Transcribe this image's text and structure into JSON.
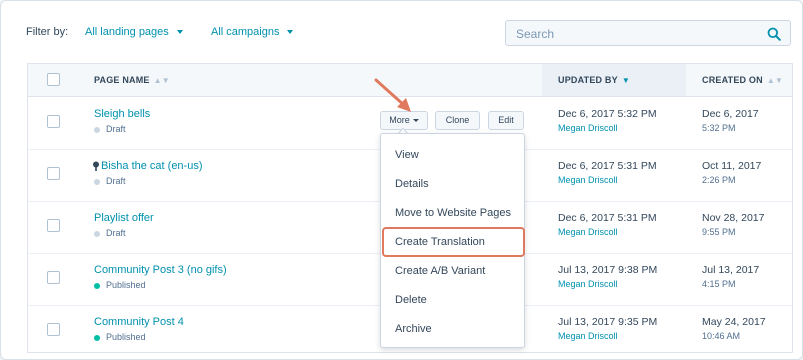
{
  "filter": {
    "label": "Filter by:",
    "landing_pages": "All landing pages",
    "campaigns": "All campaigns"
  },
  "search": {
    "placeholder": "Search"
  },
  "columns": {
    "page_name": "PAGE NAME",
    "updated_by": "UPDATED BY",
    "created_on": "CREATED ON"
  },
  "rows": [
    {
      "name": "Sleigh bells",
      "status": "Draft",
      "updated_date": "Dec 6, 2017 5:32 PM",
      "updated_user": "Megan Driscoll",
      "created_date": "Dec 6, 2017",
      "created_time": "5:32 PM"
    },
    {
      "name": "Bisha the cat (en-us)",
      "status": "Draft",
      "updated_date": "Dec 6, 2017 5:31 PM",
      "updated_user": "Megan Driscoll",
      "created_date": "Oct 11, 2017",
      "created_time": "2:26 PM"
    },
    {
      "name": "Playlist offer",
      "status": "Draft",
      "updated_date": "Dec 6, 2017 5:31 PM",
      "updated_user": "Megan Driscoll",
      "created_date": "Nov 28, 2017",
      "created_time": "9:55 PM"
    },
    {
      "name": "Community Post 3 (no gifs)",
      "status": "Published",
      "updated_date": "Jul 13, 2017 9:38 PM",
      "updated_user": "Megan Driscoll",
      "created_date": "Jul 13, 2017",
      "created_time": "4:15 PM"
    },
    {
      "name": "Community Post 4",
      "status": "Published",
      "updated_date": "Jul 13, 2017 9:35 PM",
      "updated_user": "Megan Driscoll",
      "created_date": "May 24, 2017",
      "created_time": "10:46 AM"
    }
  ],
  "row_actions": {
    "more": "More",
    "clone": "Clone",
    "edit": "Edit"
  },
  "menu": {
    "items": [
      "View",
      "Details",
      "Move to Website Pages",
      "Create Translation",
      "Create A/B Variant",
      "Delete",
      "Archive"
    ],
    "highlighted": "Create Translation"
  },
  "colors": {
    "link": "#0091ae",
    "draft_dot": "#cbd6e2",
    "published_dot": "#00bda5",
    "highlight": "#e07a5f"
  }
}
